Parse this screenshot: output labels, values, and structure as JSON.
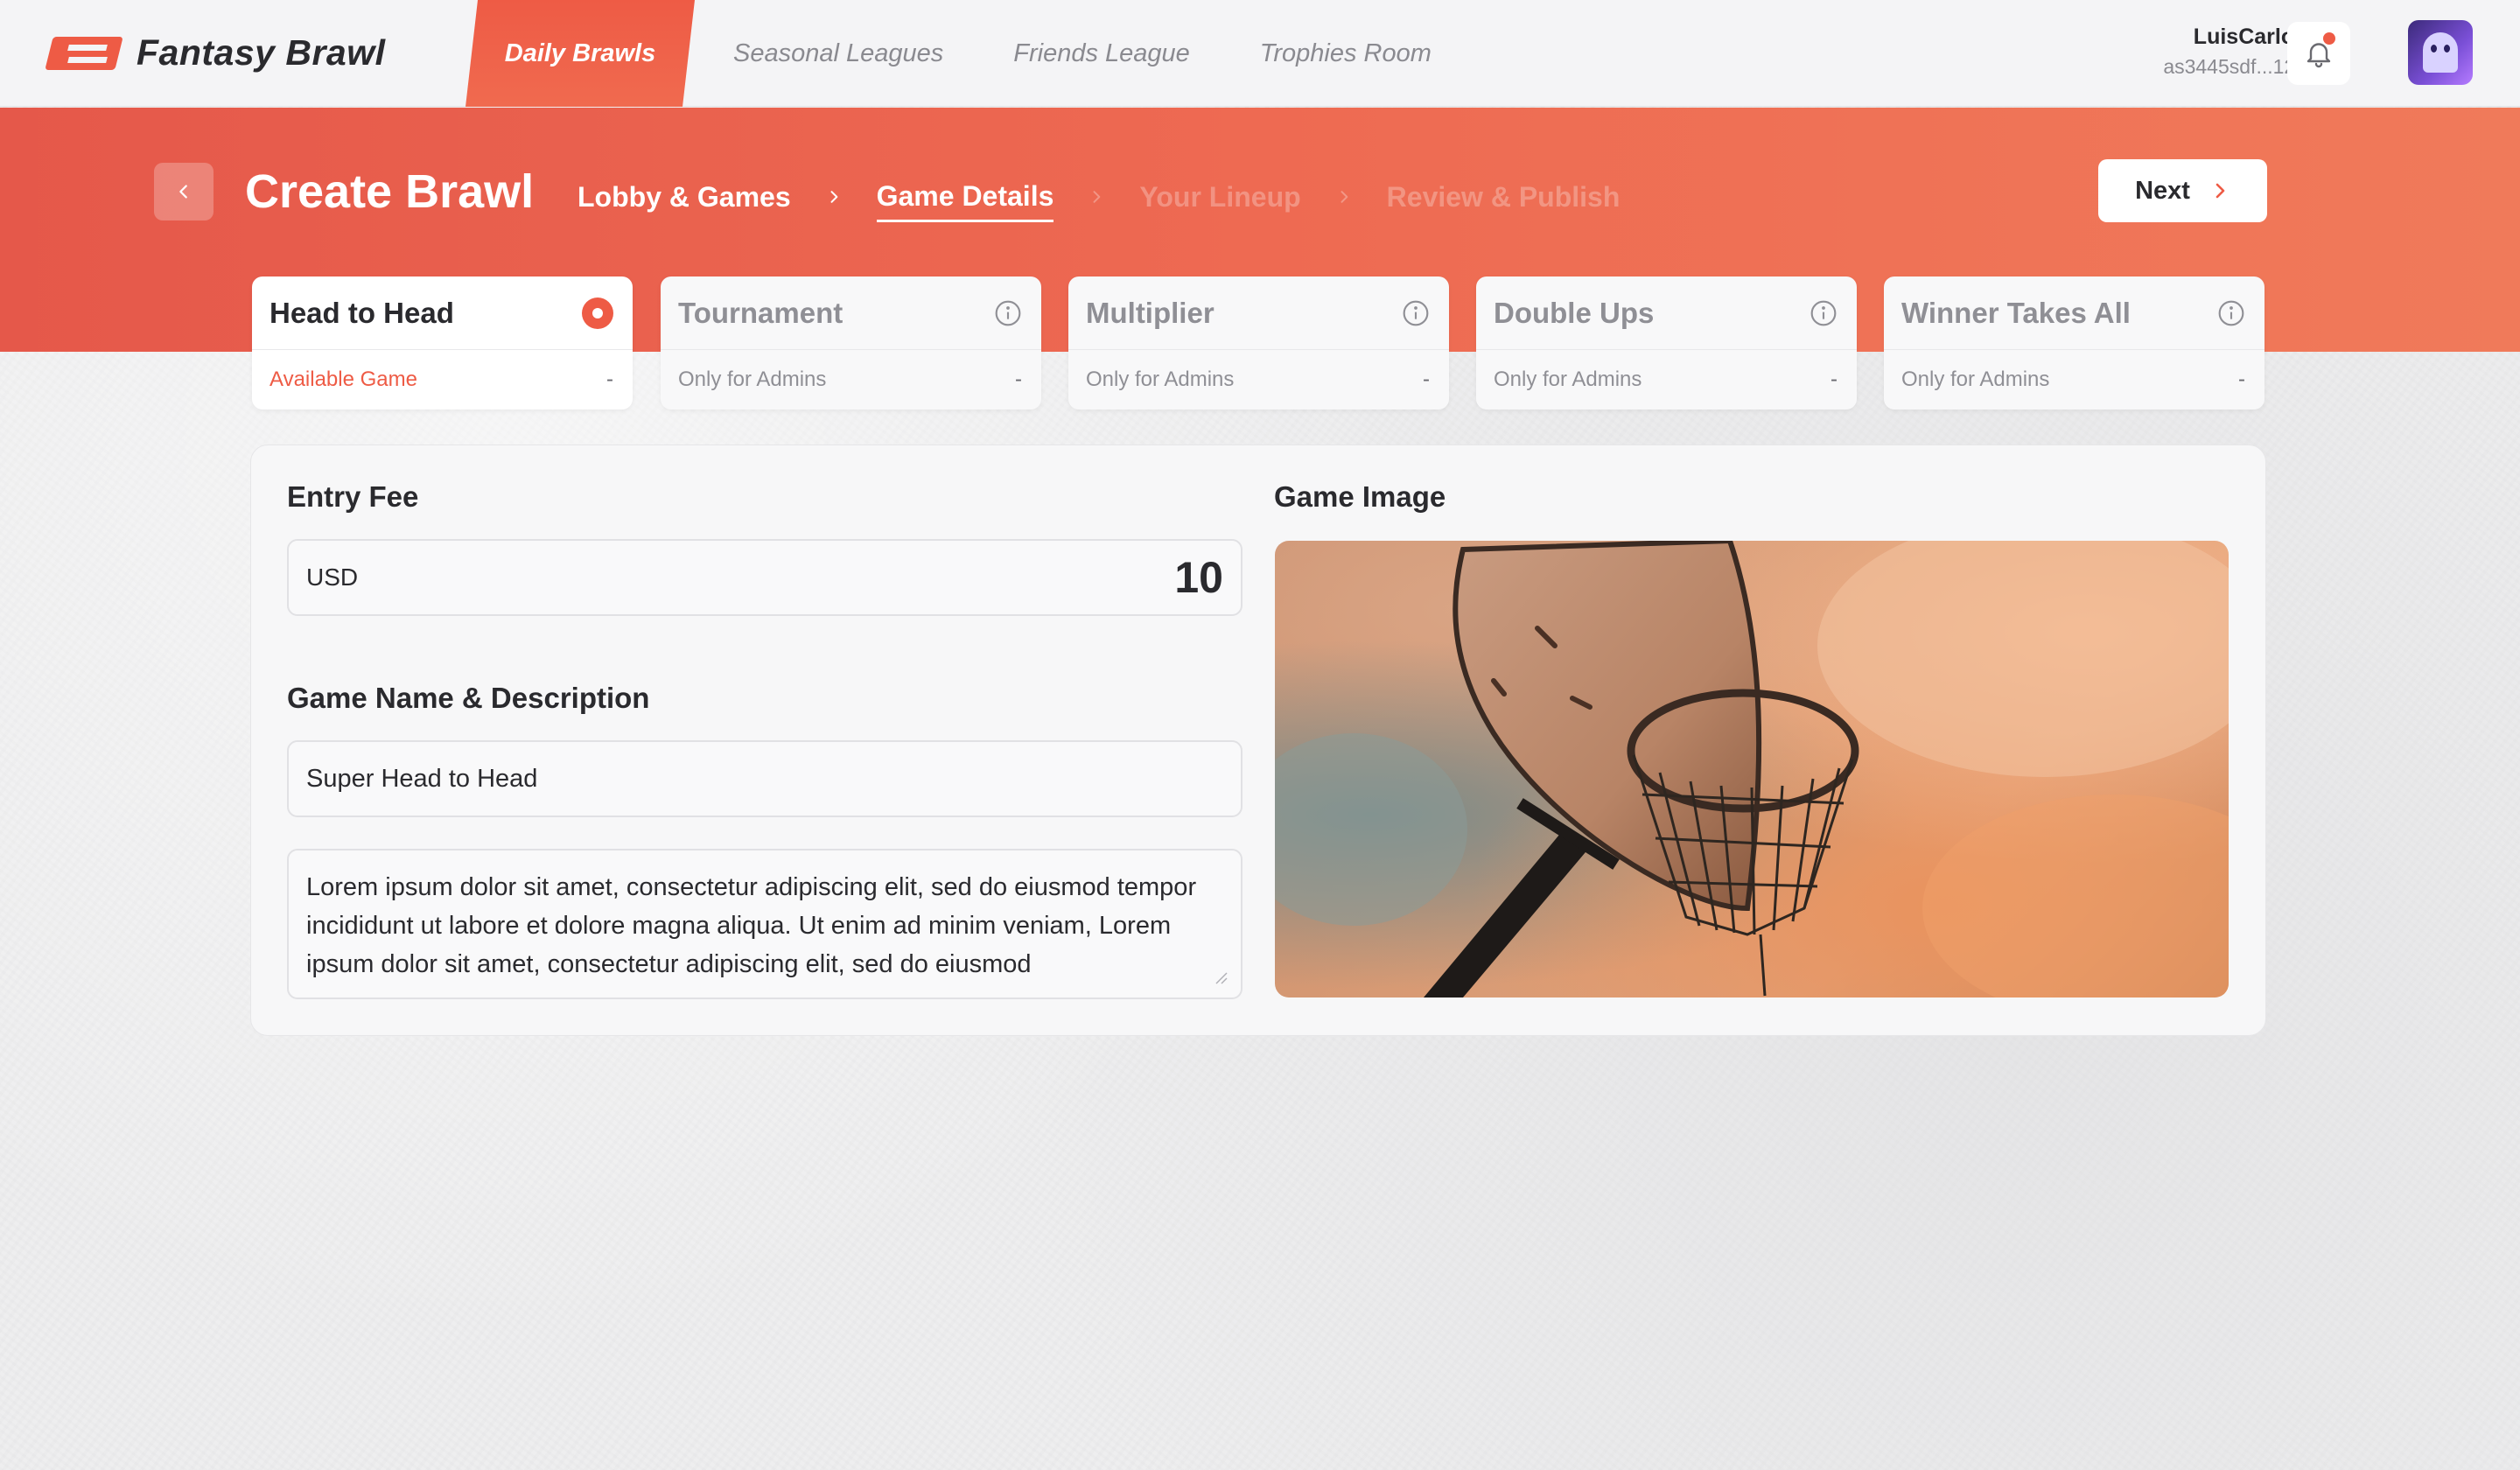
{
  "brand": {
    "name": "Fantasy Brawl"
  },
  "nav": {
    "items": [
      {
        "label": "Daily Brawls",
        "active": true
      },
      {
        "label": "Seasonal Leagues",
        "active": false
      },
      {
        "label": "Friends League",
        "active": false
      },
      {
        "label": "Trophies Room",
        "active": false
      }
    ]
  },
  "user": {
    "name": "LuisCarlos",
    "wallet": "as3445sdf...123",
    "has_notification": true
  },
  "header": {
    "title": "Create Brawl",
    "steps": [
      {
        "label": "Lobby & Games",
        "state": "done"
      },
      {
        "label": "Game Details",
        "state": "current"
      },
      {
        "label": "Your Lineup",
        "state": "future"
      },
      {
        "label": "Review & Publish",
        "state": "future"
      }
    ],
    "next_label": "Next"
  },
  "game_types": [
    {
      "title": "Head to Head",
      "subtitle": "Available Game",
      "trail": "-",
      "selected": true
    },
    {
      "title": "Tournament",
      "subtitle": "Only for Admins",
      "trail": "-",
      "selected": false
    },
    {
      "title": "Multiplier",
      "subtitle": "Only for Admins",
      "trail": "-",
      "selected": false
    },
    {
      "title": "Double Ups",
      "subtitle": "Only for Admins",
      "trail": "-",
      "selected": false
    },
    {
      "title": "Winner Takes All",
      "subtitle": "Only for Admins",
      "trail": "-",
      "selected": false
    }
  ],
  "form": {
    "entry_fee_label": "Entry Fee",
    "currency": "USD",
    "entry_fee_value": "10",
    "name_desc_label": "Game Name & Description",
    "game_name": "Super Head to Head",
    "description": "Lorem ipsum dolor sit amet, consectetur adipiscing elit, sed do eiusmod tempor incididunt ut labore et dolore magna aliqua. Ut enim ad minim veniam, Lorem ipsum dolor sit amet, consectetur adipiscing elit, sed do eiusmod",
    "game_image_label": "Game Image"
  },
  "colors": {
    "accent": "#ee5b45",
    "hero_start": "#e5584a",
    "hero_end": "#f07a5a"
  },
  "icons": {
    "back": "chevron-left-icon",
    "next": "chevron-right-icon",
    "step_sep": "chevron-right-icon",
    "bell": "bell-icon",
    "info": "info-icon",
    "selected": "radio-selected-icon"
  }
}
